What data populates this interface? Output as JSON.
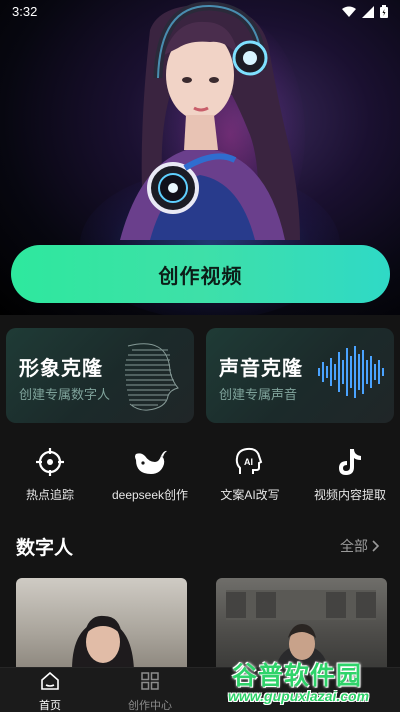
{
  "status_bar": {
    "time": "3:32"
  },
  "hero": {
    "create_button_label": "创作视频"
  },
  "feature_cards": [
    {
      "title": "形象克隆",
      "subtitle": "创建专属数字人",
      "icon": "face-scan-art"
    },
    {
      "title": "声音克隆",
      "subtitle": "创建专属声音",
      "icon": "sound-wave-art"
    }
  ],
  "tools": [
    {
      "label": "热点追踪",
      "icon": "crosshair-icon"
    },
    {
      "label": "deepseek创作",
      "icon": "whale-icon"
    },
    {
      "label": "文案AI改写",
      "icon": "ai-head-icon"
    },
    {
      "label": "视频内容提取",
      "icon": "tiktok-icon"
    }
  ],
  "section": {
    "title": "数字人",
    "more_label": "全部"
  },
  "bottom_nav": [
    {
      "label": "首页",
      "icon": "home-icon",
      "active": true
    },
    {
      "label": "创作中心",
      "icon": "grid-icon",
      "active": false
    }
  ],
  "watermark": {
    "title": "谷普软件园",
    "url": "www.gupuxlazai.com"
  },
  "colors": {
    "accent": "#2ee89e",
    "background": "#141414",
    "card": "#1f3b36"
  }
}
